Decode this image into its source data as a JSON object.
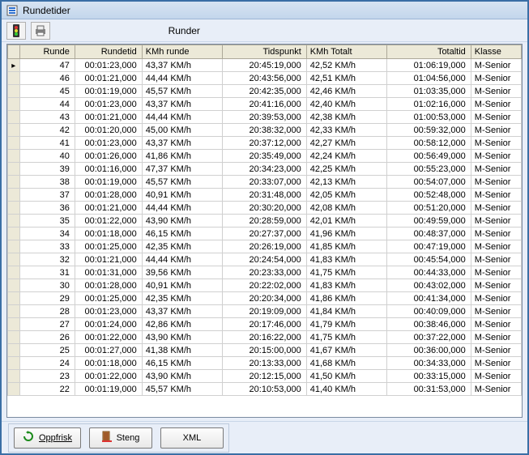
{
  "window": {
    "title": "Rundetider"
  },
  "toolbar": {
    "caption": "Runder"
  },
  "columns": {
    "runde": "Runde",
    "rundetid": "Rundetid",
    "kmh_runde": "KMh runde",
    "tidspunkt": "Tidspunkt",
    "kmh_total": "KMh Totalt",
    "totaltid": "Totaltid",
    "klasse": "Klasse"
  },
  "rows": [
    {
      "runde": "47",
      "rundetid": "00:01:23,000",
      "kmh": "43,37 KM/h",
      "tidspunkt": "20:45:19,000",
      "kmht": "42,52 KM/h",
      "totaltid": "01:06:19,000",
      "klasse": "M-Senior"
    },
    {
      "runde": "46",
      "rundetid": "00:01:21,000",
      "kmh": "44,44 KM/h",
      "tidspunkt": "20:43:56,000",
      "kmht": "42,51 KM/h",
      "totaltid": "01:04:56,000",
      "klasse": "M-Senior"
    },
    {
      "runde": "45",
      "rundetid": "00:01:19,000",
      "kmh": "45,57 KM/h",
      "tidspunkt": "20:42:35,000",
      "kmht": "42,46 KM/h",
      "totaltid": "01:03:35,000",
      "klasse": "M-Senior"
    },
    {
      "runde": "44",
      "rundetid": "00:01:23,000",
      "kmh": "43,37 KM/h",
      "tidspunkt": "20:41:16,000",
      "kmht": "42,40 KM/h",
      "totaltid": "01:02:16,000",
      "klasse": "M-Senior"
    },
    {
      "runde": "43",
      "rundetid": "00:01:21,000",
      "kmh": "44,44 KM/h",
      "tidspunkt": "20:39:53,000",
      "kmht": "42,38 KM/h",
      "totaltid": "01:00:53,000",
      "klasse": "M-Senior"
    },
    {
      "runde": "42",
      "rundetid": "00:01:20,000",
      "kmh": "45,00 KM/h",
      "tidspunkt": "20:38:32,000",
      "kmht": "42,33 KM/h",
      "totaltid": "00:59:32,000",
      "klasse": "M-Senior"
    },
    {
      "runde": "41",
      "rundetid": "00:01:23,000",
      "kmh": "43,37 KM/h",
      "tidspunkt": "20:37:12,000",
      "kmht": "42,27 KM/h",
      "totaltid": "00:58:12,000",
      "klasse": "M-Senior"
    },
    {
      "runde": "40",
      "rundetid": "00:01:26,000",
      "kmh": "41,86 KM/h",
      "tidspunkt": "20:35:49,000",
      "kmht": "42,24 KM/h",
      "totaltid": "00:56:49,000",
      "klasse": "M-Senior"
    },
    {
      "runde": "39",
      "rundetid": "00:01:16,000",
      "kmh": "47,37 KM/h",
      "tidspunkt": "20:34:23,000",
      "kmht": "42,25 KM/h",
      "totaltid": "00:55:23,000",
      "klasse": "M-Senior"
    },
    {
      "runde": "38",
      "rundetid": "00:01:19,000",
      "kmh": "45,57 KM/h",
      "tidspunkt": "20:33:07,000",
      "kmht": "42,13 KM/h",
      "totaltid": "00:54:07,000",
      "klasse": "M-Senior"
    },
    {
      "runde": "37",
      "rundetid": "00:01:28,000",
      "kmh": "40,91 KM/h",
      "tidspunkt": "20:31:48,000",
      "kmht": "42,05 KM/h",
      "totaltid": "00:52:48,000",
      "klasse": "M-Senior"
    },
    {
      "runde": "36",
      "rundetid": "00:01:21,000",
      "kmh": "44,44 KM/h",
      "tidspunkt": "20:30:20,000",
      "kmht": "42,08 KM/h",
      "totaltid": "00:51:20,000",
      "klasse": "M-Senior"
    },
    {
      "runde": "35",
      "rundetid": "00:01:22,000",
      "kmh": "43,90 KM/h",
      "tidspunkt": "20:28:59,000",
      "kmht": "42,01 KM/h",
      "totaltid": "00:49:59,000",
      "klasse": "M-Senior"
    },
    {
      "runde": "34",
      "rundetid": "00:01:18,000",
      "kmh": "46,15 KM/h",
      "tidspunkt": "20:27:37,000",
      "kmht": "41,96 KM/h",
      "totaltid": "00:48:37,000",
      "klasse": "M-Senior"
    },
    {
      "runde": "33",
      "rundetid": "00:01:25,000",
      "kmh": "42,35 KM/h",
      "tidspunkt": "20:26:19,000",
      "kmht": "41,85 KM/h",
      "totaltid": "00:47:19,000",
      "klasse": "M-Senior"
    },
    {
      "runde": "32",
      "rundetid": "00:01:21,000",
      "kmh": "44,44 KM/h",
      "tidspunkt": "20:24:54,000",
      "kmht": "41,83 KM/h",
      "totaltid": "00:45:54,000",
      "klasse": "M-Senior"
    },
    {
      "runde": "31",
      "rundetid": "00:01:31,000",
      "kmh": "39,56 KM/h",
      "tidspunkt": "20:23:33,000",
      "kmht": "41,75 KM/h",
      "totaltid": "00:44:33,000",
      "klasse": "M-Senior"
    },
    {
      "runde": "30",
      "rundetid": "00:01:28,000",
      "kmh": "40,91 KM/h",
      "tidspunkt": "20:22:02,000",
      "kmht": "41,83 KM/h",
      "totaltid": "00:43:02,000",
      "klasse": "M-Senior"
    },
    {
      "runde": "29",
      "rundetid": "00:01:25,000",
      "kmh": "42,35 KM/h",
      "tidspunkt": "20:20:34,000",
      "kmht": "41,86 KM/h",
      "totaltid": "00:41:34,000",
      "klasse": "M-Senior"
    },
    {
      "runde": "28",
      "rundetid": "00:01:23,000",
      "kmh": "43,37 KM/h",
      "tidspunkt": "20:19:09,000",
      "kmht": "41,84 KM/h",
      "totaltid": "00:40:09,000",
      "klasse": "M-Senior"
    },
    {
      "runde": "27",
      "rundetid": "00:01:24,000",
      "kmh": "42,86 KM/h",
      "tidspunkt": "20:17:46,000",
      "kmht": "41,79 KM/h",
      "totaltid": "00:38:46,000",
      "klasse": "M-Senior"
    },
    {
      "runde": "26",
      "rundetid": "00:01:22,000",
      "kmh": "43,90 KM/h",
      "tidspunkt": "20:16:22,000",
      "kmht": "41,75 KM/h",
      "totaltid": "00:37:22,000",
      "klasse": "M-Senior"
    },
    {
      "runde": "25",
      "rundetid": "00:01:27,000",
      "kmh": "41,38 KM/h",
      "tidspunkt": "20:15:00,000",
      "kmht": "41,67 KM/h",
      "totaltid": "00:36:00,000",
      "klasse": "M-Senior"
    },
    {
      "runde": "24",
      "rundetid": "00:01:18,000",
      "kmh": "46,15 KM/h",
      "tidspunkt": "20:13:33,000",
      "kmht": "41,68 KM/h",
      "totaltid": "00:34:33,000",
      "klasse": "M-Senior"
    },
    {
      "runde": "23",
      "rundetid": "00:01:22,000",
      "kmh": "43,90 KM/h",
      "tidspunkt": "20:12:15,000",
      "kmht": "41,50 KM/h",
      "totaltid": "00:33:15,000",
      "klasse": "M-Senior"
    },
    {
      "runde": "22",
      "rundetid": "00:01:19,000",
      "kmh": "45,57 KM/h",
      "tidspunkt": "20:10:53,000",
      "kmht": "41,40 KM/h",
      "totaltid": "00:31:53,000",
      "klasse": "M-Senior"
    }
  ],
  "buttons": {
    "refresh": "Oppfrisk",
    "close": "Steng",
    "xml": "XML"
  },
  "icons": {
    "traffic": "traffic-light-icon",
    "print": "print-icon",
    "refresh": "refresh-icon",
    "close": "door-icon"
  }
}
